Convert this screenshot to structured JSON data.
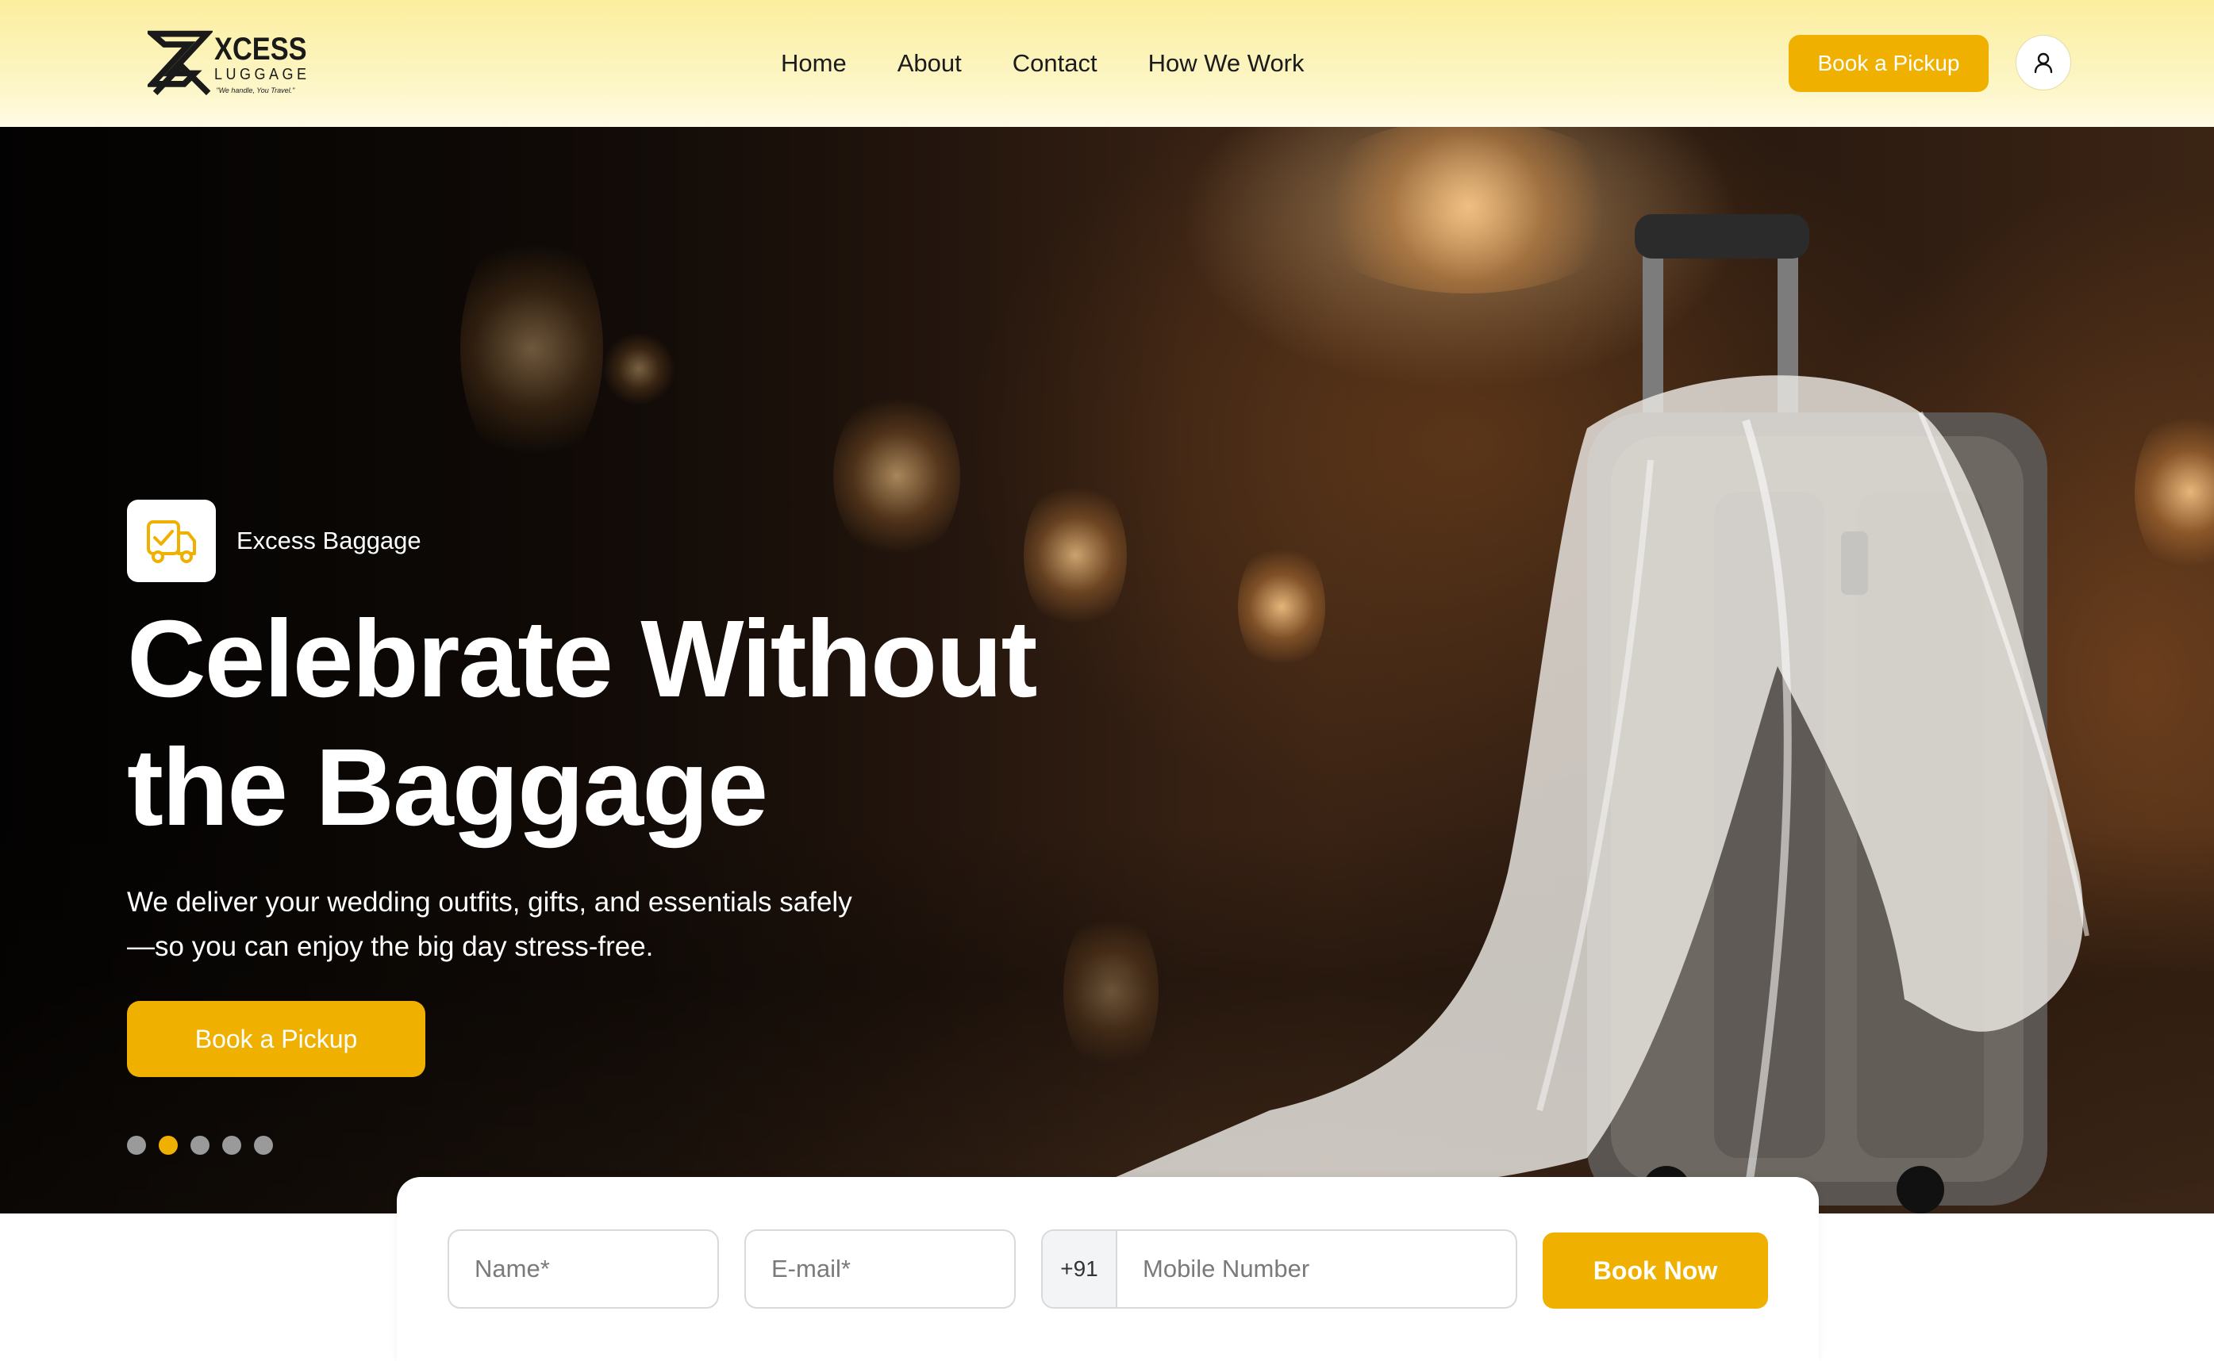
{
  "brand": {
    "name_main": "XCESS",
    "name_sub": "LUGGAGE",
    "tagline": "\"We handle, You Travel.\""
  },
  "nav": {
    "items": [
      {
        "label": "Home"
      },
      {
        "label": "About"
      },
      {
        "label": "Contact"
      },
      {
        "label": "How We Work"
      }
    ]
  },
  "header": {
    "cta_label": "Book a Pickup",
    "account_icon": "user-icon"
  },
  "hero": {
    "badge_icon": "delivery-truck-check-icon",
    "badge_label": "Excess Baggage",
    "title_line1": "Celebrate Without",
    "title_line2": "the Baggage",
    "subtitle_line1": "We deliver your wedding outfits, gifts, and essentials safely",
    "subtitle_line2": "—so you can enjoy the big day stress-free.",
    "cta_label": "Book a Pickup",
    "slides_count": 5,
    "active_slide": 2
  },
  "booking_form": {
    "name_placeholder": "Name*",
    "email_placeholder": "E-mail*",
    "phone_code": "+91",
    "phone_placeholder": "Mobile Number",
    "submit_label": "Book Now"
  },
  "colors": {
    "accent": "#f0b000",
    "header_gradient_top": "#fbee9e",
    "text_dark": "#1b1b1b"
  }
}
